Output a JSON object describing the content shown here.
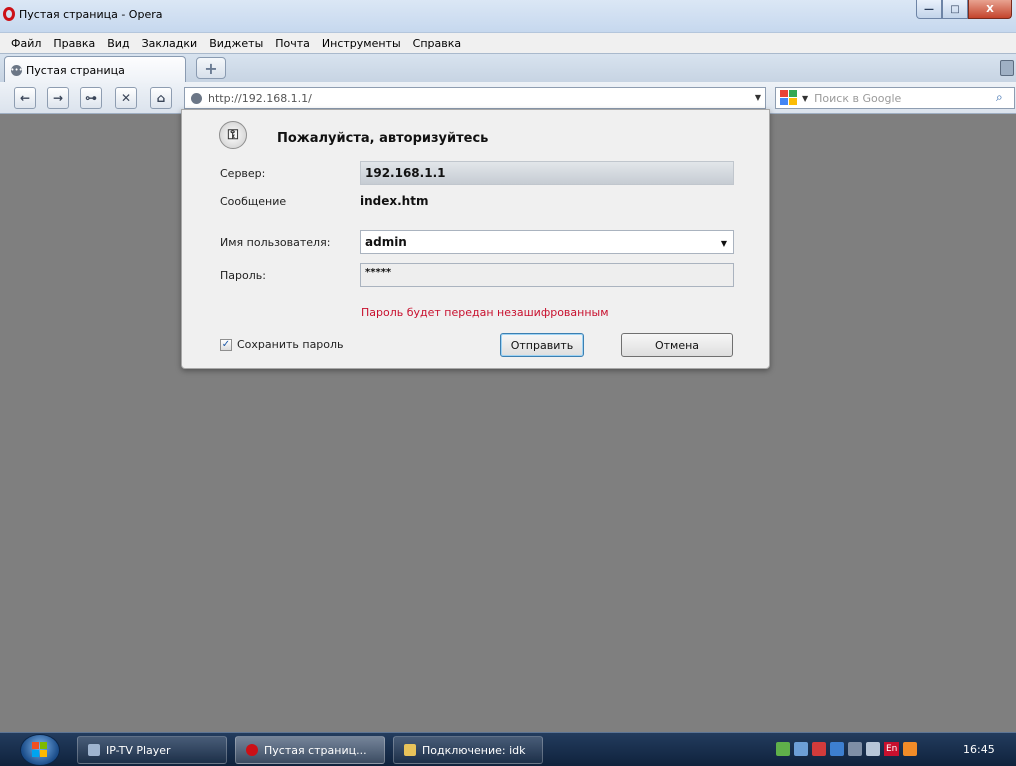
{
  "window": {
    "title": "Пустая страница - Opera",
    "buttons": {
      "minimize": "—",
      "maximize": "□",
      "close": "X"
    }
  },
  "menubar": {
    "items": [
      "Файл",
      "Правка",
      "Вид",
      "Закладки",
      "Виджеты",
      "Почта",
      "Инструменты",
      "Справка"
    ]
  },
  "tabs": {
    "active_tab": "Пустая страница",
    "new_tab_symbol": "+"
  },
  "toolbar": {
    "back": "←",
    "forward": "→",
    "wand": "⊶",
    "stop": "✕",
    "home": "⌂",
    "address": "http://192.168.1.1/",
    "search_placeholder": "Поиск в Google",
    "search_icon": "search-icon"
  },
  "dialog": {
    "title": "Пожалуйста, авторизуйтесь",
    "server_label": "Сервер:",
    "server_value": "192.168.1.1",
    "message_label": "Сообщение",
    "message_value": "index.htm",
    "username_label": "Имя пользователя:",
    "username_value": "admin",
    "password_label": "Пароль:",
    "password_value": "*****",
    "warning": "Пароль будет передан незашифрованным",
    "save_password_label": "Сохранить пароль",
    "save_password_checked": true,
    "submit_label": "Отправить",
    "cancel_label": "Отмена"
  },
  "taskbar": {
    "items": [
      {
        "label": "IP-TV Player",
        "active": false
      },
      {
        "label": "Пустая страниц...",
        "active": true
      },
      {
        "label": "Подключение: idk",
        "active": false
      }
    ],
    "language": "En",
    "clock": "16:45"
  },
  "colors": {
    "page_background": "#7f7f7f",
    "warning_text": "#c8102e",
    "opera_red": "#cc1016"
  }
}
